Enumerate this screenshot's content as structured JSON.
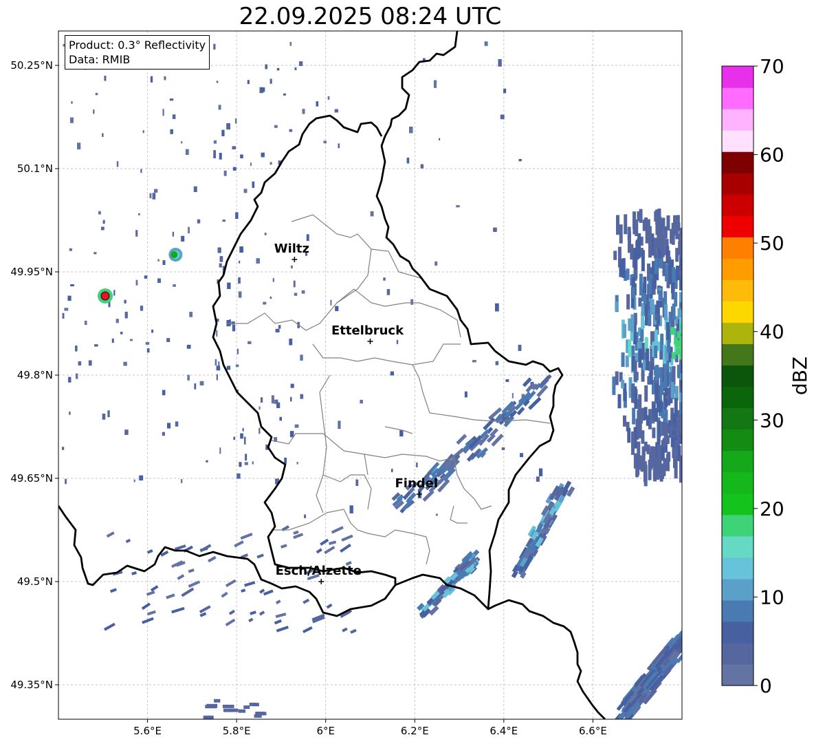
{
  "title": "22.09.2025 08:24 UTC",
  "info": {
    "product": "Product: 0.3° Reflectivity",
    "data": "Data: RMIB"
  },
  "map": {
    "lon_range": [
      5.4,
      6.8
    ],
    "lat_range": [
      49.3,
      50.3
    ],
    "lon_ticks": [
      {
        "value": 5.6,
        "label": "5.6°E"
      },
      {
        "value": 5.8,
        "label": "5.8°E"
      },
      {
        "value": 6.0,
        "label": "6°E"
      },
      {
        "value": 6.2,
        "label": "6.2°E"
      },
      {
        "value": 6.4,
        "label": "6.4°E"
      },
      {
        "value": 6.6,
        "label": "6.6°E"
      }
    ],
    "lat_ticks": [
      {
        "value": 50.25,
        "label": "50.25°N"
      },
      {
        "value": 50.1,
        "label": "50.1°N"
      },
      {
        "value": 49.95,
        "label": "49.95°N"
      },
      {
        "value": 49.8,
        "label": "49.8°N"
      },
      {
        "value": 49.65,
        "label": "49.65°N"
      },
      {
        "value": 49.5,
        "label": "49.5°N"
      },
      {
        "value": 49.35,
        "label": "49.35°N"
      }
    ],
    "cities": [
      {
        "name": "Wiltz",
        "lon": 5.93,
        "lat": 49.968
      },
      {
        "name": "Ettelbruck",
        "lon": 6.1,
        "lat": 49.849
      },
      {
        "name": "Findel",
        "lon": 6.21,
        "lat": 49.627
      },
      {
        "name": "Esch/Alzette",
        "lon": 5.99,
        "lat": 49.5
      }
    ],
    "radar_site": {
      "lon": 5.505,
      "lat": 49.915,
      "color": "#e8141e"
    }
  },
  "colorbar": {
    "label": "dBZ",
    "min": 0,
    "max": 70,
    "tick_values": [
      0,
      10,
      20,
      30,
      40,
      50,
      60,
      70
    ],
    "colors": [
      "#6374a4",
      "#56679f",
      "#4760a0",
      "#4a7ab2",
      "#5aa0c8",
      "#66c3d9",
      "#66d9c5",
      "#3fd377",
      "#14c41c",
      "#14b81a",
      "#14a81a",
      "#148c14",
      "#137813",
      "#0b660b",
      "#0b560b",
      "#44761a",
      "#adb40b",
      "#ffd700",
      "#ffbb0a",
      "#ff9c00",
      "#ff7f00",
      "#ee0000",
      "#cc0000",
      "#a80000",
      "#7f0000",
      "#ffe0ff",
      "#ffb3ff",
      "#ff6bff",
      "#e830ea"
    ]
  }
}
